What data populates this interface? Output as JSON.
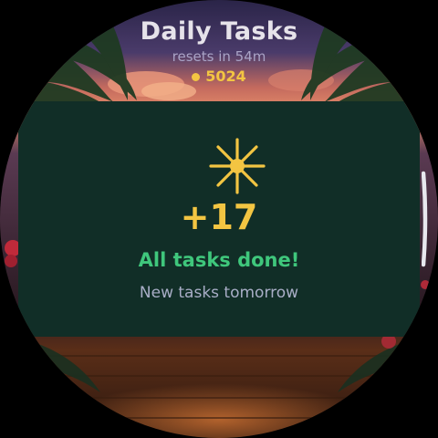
{
  "header": {
    "title": "Daily Tasks",
    "reset_text": "resets in 54m",
    "coin_balance": "5024"
  },
  "card": {
    "icon": "sun-icon",
    "points": "+17",
    "status": "All tasks done!",
    "note": "New tasks tomorrow"
  },
  "colors": {
    "accent_gold": "#f3c542",
    "success_green": "#3fc77c",
    "card_background": "#112e27"
  },
  "scroll": {
    "indicator": "scroll-indicator"
  }
}
